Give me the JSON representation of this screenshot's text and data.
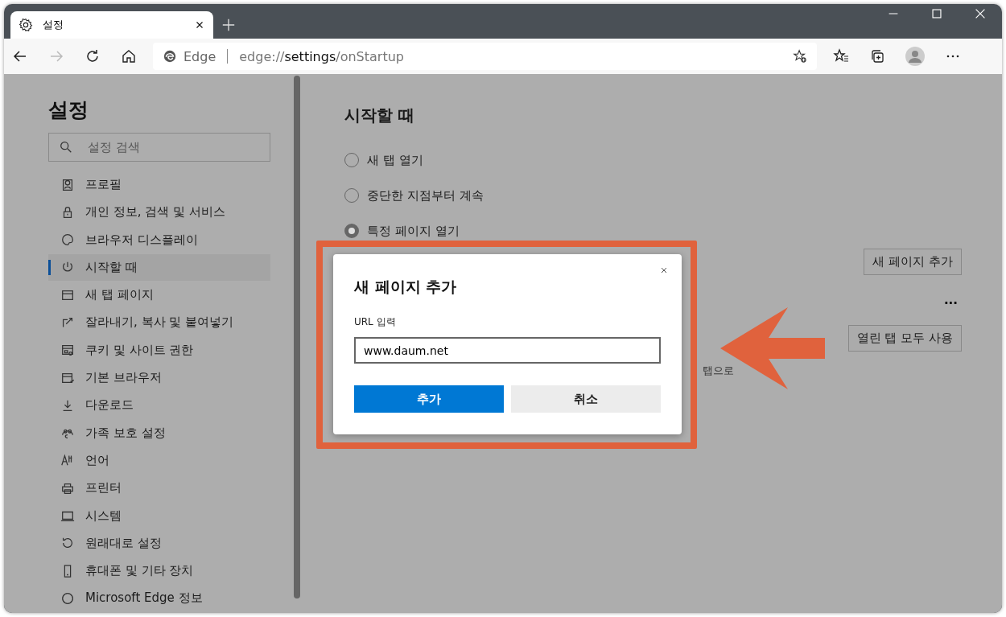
{
  "browser": {
    "tab": {
      "title": "설정",
      "selected": true
    },
    "address": {
      "brand": "Edge",
      "url_prefix": "edge://",
      "url_host": "settings",
      "url_path": "/onStartup"
    }
  },
  "sidebar": {
    "title": "설정",
    "search": {
      "placeholder": "설정 검색"
    },
    "items": [
      {
        "label": "프로필",
        "selected": false
      },
      {
        "label": "개인 정보, 검색 및 서비스",
        "selected": false
      },
      {
        "label": "브라우저 디스플레이",
        "selected": false
      },
      {
        "label": "시작할 때",
        "selected": true
      },
      {
        "label": "새 탭 페이지",
        "selected": false
      },
      {
        "label": "잘라내기, 복사 및 붙여넣기",
        "selected": false
      },
      {
        "label": "쿠키 및 사이트 권한",
        "selected": false
      },
      {
        "label": "기본 브라우저",
        "selected": false
      },
      {
        "label": "다운로드",
        "selected": false
      },
      {
        "label": "가족 보호 설정",
        "selected": false
      },
      {
        "label": "언어",
        "selected": false
      },
      {
        "label": "프린터",
        "selected": false
      },
      {
        "label": "시스템",
        "selected": false
      },
      {
        "label": "원래대로 설정",
        "selected": false
      },
      {
        "label": "휴대폰 및 기타 장치",
        "selected": false
      },
      {
        "label": "Microsoft Edge 정보",
        "selected": false
      }
    ]
  },
  "main": {
    "title": "시작할 때",
    "options": [
      {
        "label": "새 탭 열기",
        "selected": false
      },
      {
        "label": "중단한 지점부터 계속",
        "selected": false
      },
      {
        "label": "특정 페이지 열기",
        "selected": true
      }
    ],
    "add_page_button": "새 페이지 추가",
    "more": "...",
    "use_open_tabs_button": "열린 탭 모두 사용",
    "hint": "탭으로"
  },
  "dialog": {
    "title": "새 페이지 추가",
    "field_label": "URL 입력",
    "value": "www.daum.net",
    "add_button": "추가",
    "cancel_button": "취소"
  }
}
